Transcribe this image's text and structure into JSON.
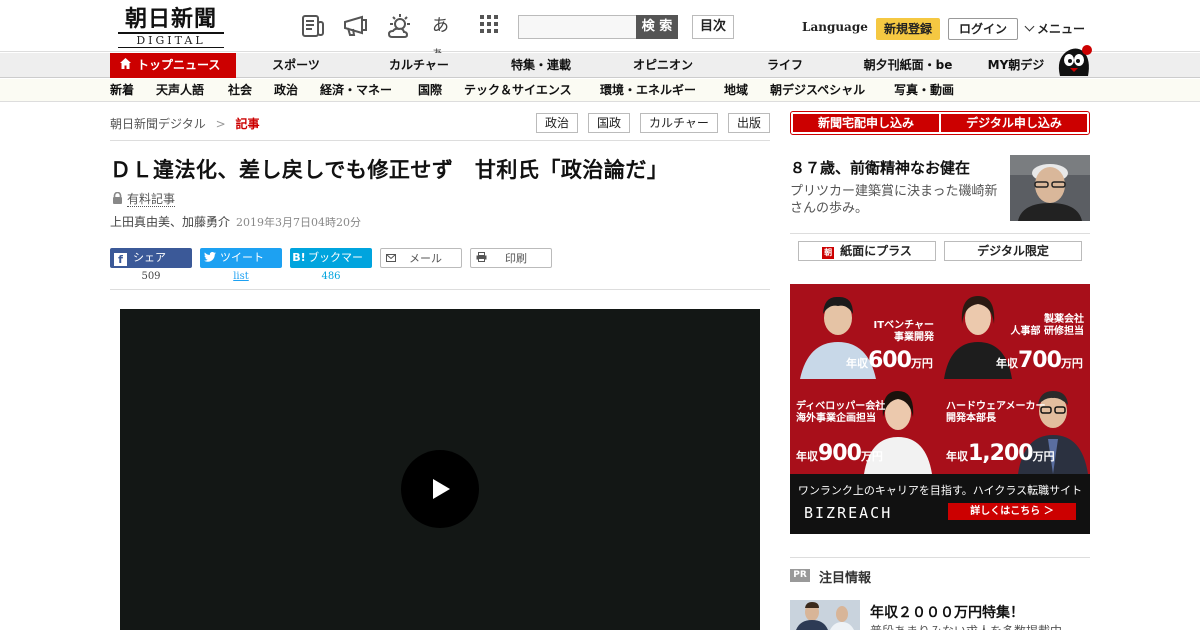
{
  "header": {
    "logo_jp": "朝日新聞",
    "logo_en": "DIGITAL",
    "icons": [
      "newspaper-icon",
      "megaphone-icon",
      "weather-icon",
      "font-size-icon",
      "grid-icon"
    ],
    "font_glyph": "あ",
    "font_glyph_small": "あ",
    "search_placeholder": "",
    "search_label": "検 索",
    "toc_label": "目次",
    "language_label": "Language",
    "register_label": "新規登録",
    "login_label": "ログイン",
    "menu_label": "メニュー"
  },
  "nav_main": {
    "top_label": "トップニュース",
    "items": [
      "スポーツ",
      "カルチャー",
      "特集・連載",
      "オピニオン",
      "ライフ",
      "朝夕刊紙面・be",
      "MY朝デジ"
    ]
  },
  "nav_sub": {
    "items": [
      "新着",
      "天声人語",
      "社会",
      "政治",
      "経済・マネー",
      "国際",
      "テック＆サイエンス",
      "環境・エネルギー",
      "地域",
      "朝デジスペシャル",
      "写真・動画"
    ]
  },
  "breadcrumb": {
    "home": "朝日新聞デジタル",
    "sep": ">",
    "current": "記事"
  },
  "tags": [
    "政治",
    "国政",
    "カルチャー",
    "出版"
  ],
  "article": {
    "title": "ＤＬ違法化、差し戻しでも修正せず　甘利氏「政治論だ」",
    "paid_label": "有料記事",
    "authors": "上田真由美、加藤勇介",
    "date": "2019年3月7日04時20分"
  },
  "share": {
    "facebook_label": "シェア",
    "facebook_count": "509",
    "twitter_label": "ツイート",
    "twitter_count": "list",
    "hatena_label": "ブックマーク",
    "hatena_icon_text": "B!",
    "hatena_count": "486",
    "mail_label": "メール",
    "print_label": "印刷"
  },
  "sidebar": {
    "subscribe_home": "新聞宅配申し込み",
    "subscribe_digital": "デジタル申し込み",
    "feature_title": "８７歳、前衛精神なお健在",
    "feature_desc": "プリツカー建築賞に決まった磯崎新さんの歩み。",
    "link_paper_plus": "紙面にプラス",
    "link_digital_only": "デジタル限定",
    "paper_plus_icon_text": "朝",
    "pr_badge": "PR",
    "pr_title": "注目情報",
    "pr_headline": "年収２０００万円特集！",
    "pr_sub": "普段あまりみない求人を多数掲載中"
  },
  "ad": {
    "cells": [
      {
        "role1": "ITベンチャー",
        "role2": "事業開発",
        "prefix": "年収",
        "amount": "600",
        "unit": "万円"
      },
      {
        "role1": "製薬会社",
        "role2": "人事部 研修担当",
        "prefix": "年収",
        "amount": "700",
        "unit": "万円"
      },
      {
        "role1": "ディベロッパー会社",
        "role2": "海外事業企画担当",
        "prefix": "年収",
        "amount": "900",
        "unit": "万円"
      },
      {
        "role1": "ハードウェアメーカー",
        "role2": "開発本部長",
        "prefix": "年収",
        "amount": "1,200",
        "unit": "万円"
      }
    ],
    "tagline": "ワンランク上のキャリアを目指す。ハイクラス転職サイト",
    "brand": "BIZREACH",
    "cta": "詳しくはこちら ＞"
  },
  "colors": {
    "brand_red": "#cc0000",
    "facebook": "#3b5998",
    "twitter": "#1da1f2",
    "hatena": "#00a4de",
    "register_yellow": "#f5c842"
  }
}
